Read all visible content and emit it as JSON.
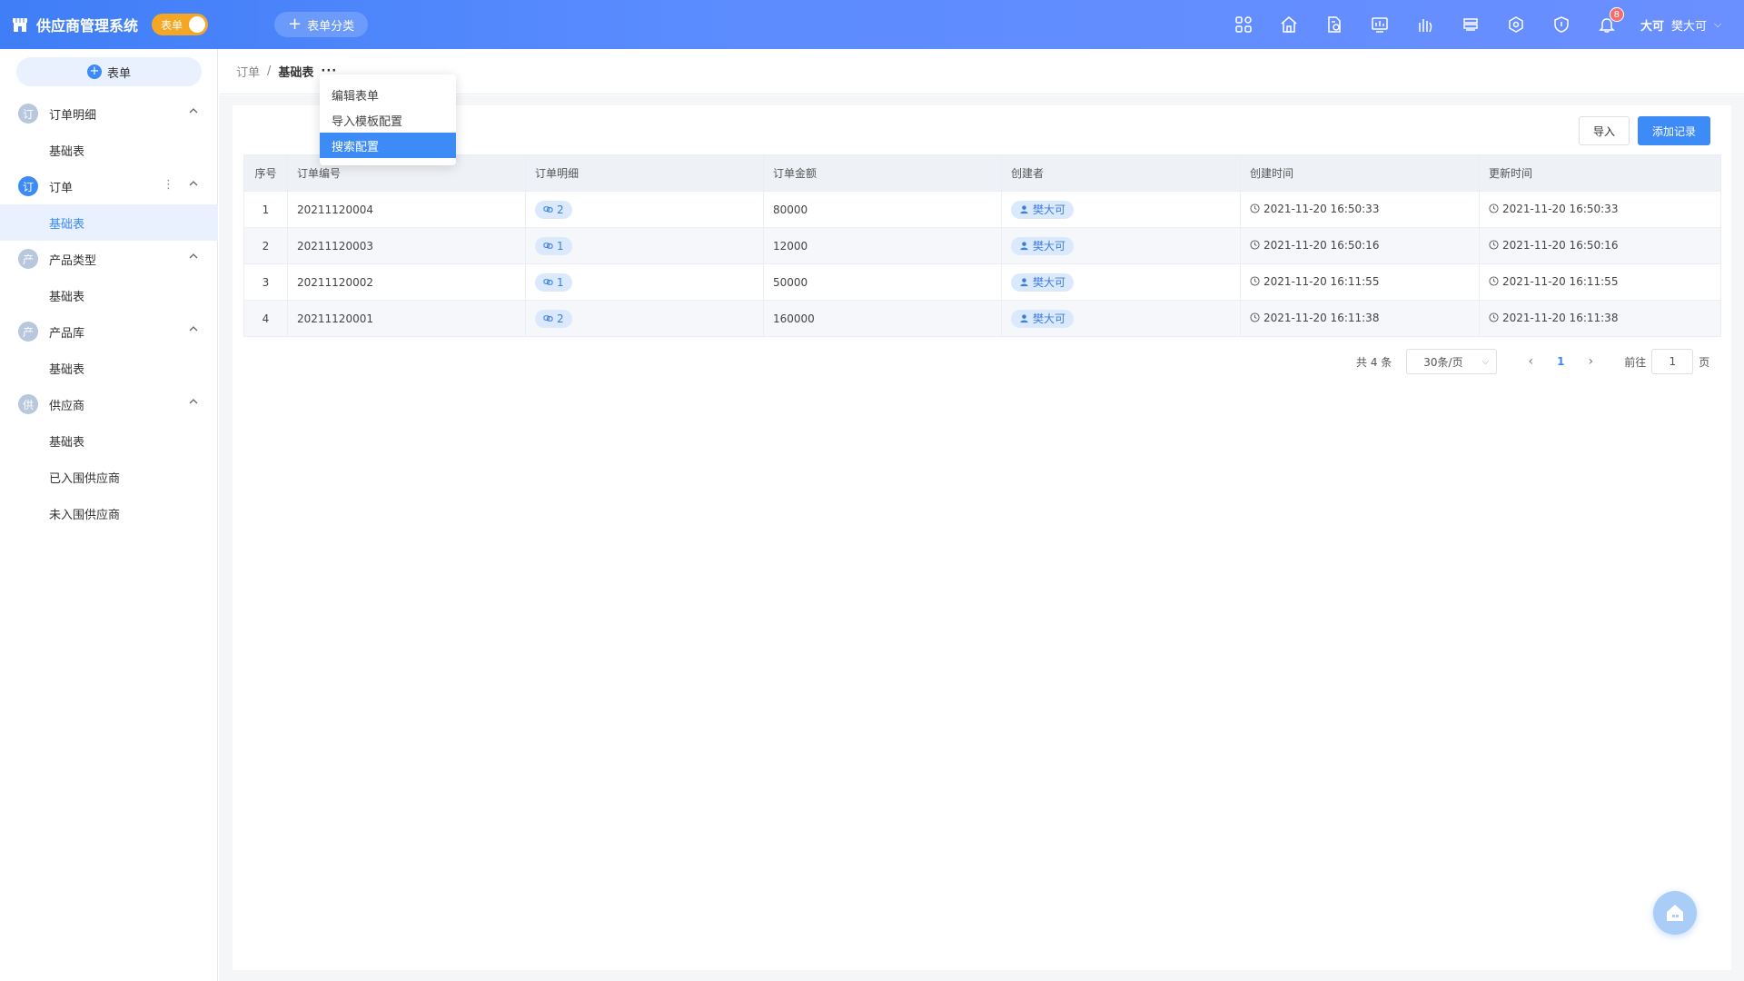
{
  "header": {
    "title": "供应商管理系统",
    "mode_label": "表单",
    "category_button": "表单分类",
    "notification_count": "8",
    "user_avatar": "大可",
    "user_name": "樊大可"
  },
  "sidebar": {
    "new_button": "表单",
    "groups": [
      {
        "icon_char": "订",
        "label": "订单明细",
        "items": [
          "基础表"
        ]
      },
      {
        "icon_char": "订",
        "label": "订单",
        "items": [
          "基础表"
        ]
      },
      {
        "icon_char": "产",
        "label": "产品类型",
        "items": [
          "基础表"
        ]
      },
      {
        "icon_char": "产",
        "label": "产品库",
        "items": [
          "基础表"
        ]
      },
      {
        "icon_char": "供",
        "label": "供应商",
        "items": [
          "基础表",
          "已入围供应商",
          "未入围供应商"
        ]
      }
    ],
    "more_glyph": "⋮"
  },
  "breadcrumb": {
    "parent": "订单",
    "separator": "/",
    "current": "基础表",
    "more": "···"
  },
  "dropdown": {
    "items": [
      "编辑表单",
      "导入模板配置",
      "搜索配置"
    ],
    "active_index": 2
  },
  "toolbar": {
    "import_label": "导入",
    "add_label": "添加记录"
  },
  "table": {
    "headers": [
      "序号",
      "订单编号",
      "订单明细",
      "订单金额",
      "创建者",
      "创建时间",
      "更新时间"
    ],
    "rows": [
      {
        "index": "1",
        "order_no": "20211120004",
        "detail_count": "2",
        "amount": "80000",
        "creator": "樊大可",
        "created": "2021-11-20 16:50:33",
        "updated": "2021-11-20 16:50:33"
      },
      {
        "index": "2",
        "order_no": "20211120003",
        "detail_count": "1",
        "amount": "12000",
        "creator": "樊大可",
        "created": "2021-11-20 16:50:16",
        "updated": "2021-11-20 16:50:16"
      },
      {
        "index": "3",
        "order_no": "20211120002",
        "detail_count": "1",
        "amount": "50000",
        "creator": "樊大可",
        "created": "2021-11-20 16:11:55",
        "updated": "2021-11-20 16:11:55"
      },
      {
        "index": "4",
        "order_no": "20211120001",
        "detail_count": "2",
        "amount": "160000",
        "creator": "樊大可",
        "created": "2021-11-20 16:11:38",
        "updated": "2021-11-20 16:11:38"
      }
    ]
  },
  "pagination": {
    "total": "共 4 条",
    "page_size": "30条/页",
    "current_page": "1",
    "goto_label": "前往",
    "goto_value": "1",
    "page_suffix": "页"
  },
  "colors": {
    "accent": "#3d8bf7",
    "toggle": "#f5a623",
    "badge": "#f56c6c"
  }
}
